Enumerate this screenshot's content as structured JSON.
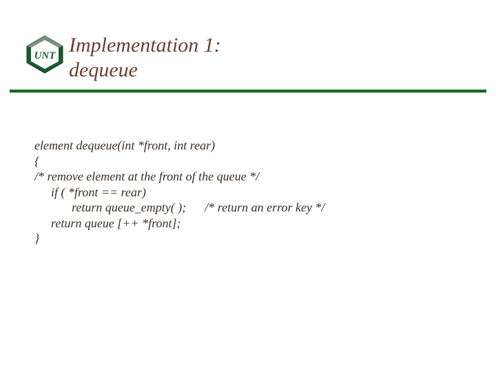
{
  "title": {
    "line1": "Implementation 1:",
    "line2": "dequeue"
  },
  "code": {
    "l1": "element dequeue(int *front, int rear)",
    "l2": "{",
    "l3": "/* remove element at the front of the queue */",
    "l4": "if ( *front == rear)",
    "l5a": "return queue_empty( );",
    "l5b": "/* return an error key */",
    "l6": "return queue [++ *front];",
    "l7": "}"
  },
  "logo_alt": "UNT North Texas logo"
}
